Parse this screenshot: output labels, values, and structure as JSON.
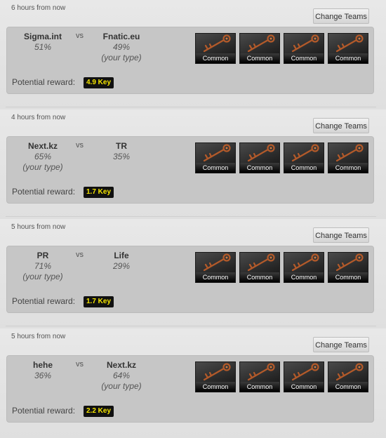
{
  "matches": [
    {
      "time": "6 hours from now",
      "change_label": "Change Teams",
      "team1": {
        "name": "Sigma.int",
        "pct": "51%",
        "note": ""
      },
      "vs": "vs",
      "team2": {
        "name": "Fnatic.eu",
        "pct": "49%",
        "note": "(your type)"
      },
      "reward_label": "Potential reward:",
      "reward": "4.9 Key",
      "items": [
        "Common",
        "Common",
        "Common",
        "Common"
      ]
    },
    {
      "time": "4 hours from now",
      "change_label": "Change Teams",
      "team1": {
        "name": "Next.kz",
        "pct": "65%",
        "note": "(your type)"
      },
      "vs": "vs",
      "team2": {
        "name": "TR",
        "pct": "35%",
        "note": ""
      },
      "reward_label": "Potential reward:",
      "reward": "1.7 Key",
      "items": [
        "Common",
        "Common",
        "Common",
        "Common"
      ]
    },
    {
      "time": "5 hours from now",
      "change_label": "Change Teams",
      "team1": {
        "name": "PR",
        "pct": "71%",
        "note": "(your type)"
      },
      "vs": "vs",
      "team2": {
        "name": "Life",
        "pct": "29%",
        "note": ""
      },
      "reward_label": "Potential reward:",
      "reward": "1.7 Key",
      "items": [
        "Common",
        "Common",
        "Common",
        "Common"
      ]
    },
    {
      "time": "5 hours from now",
      "change_label": "Change Teams",
      "team1": {
        "name": "hehe",
        "pct": "36%",
        "note": ""
      },
      "vs": "vs",
      "team2": {
        "name": "Next.kz",
        "pct": "64%",
        "note": "(your type)"
      },
      "reward_label": "Potential reward:",
      "reward": "2.2 Key",
      "items": [
        "Common",
        "Common",
        "Common",
        "Common"
      ]
    }
  ],
  "colors": {
    "reward_text": "#f5e600",
    "reward_bg": "#111111",
    "card_bg": "#c6c6c6"
  },
  "icons": {
    "item": "key-icon"
  }
}
